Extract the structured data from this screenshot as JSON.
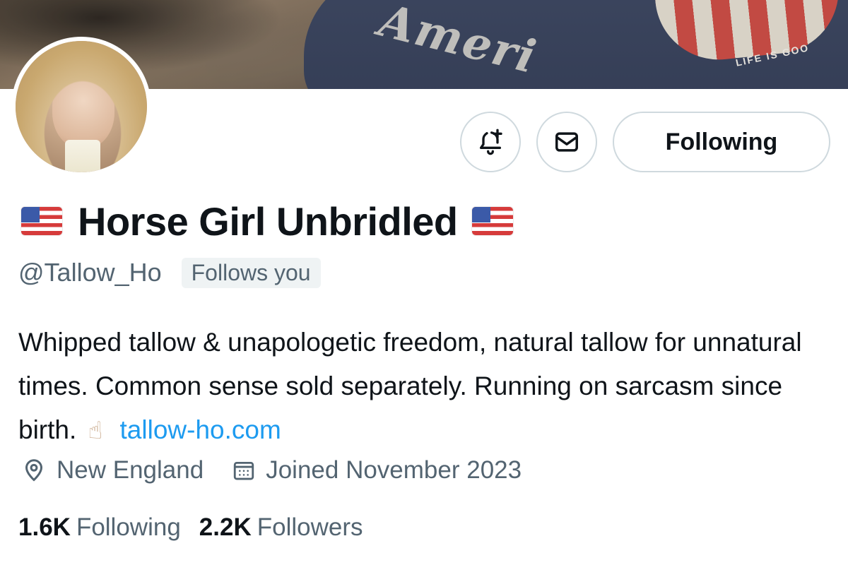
{
  "banner": {
    "shirt_text": "Ameri",
    "shirt_brand": "LIFE IS GOO"
  },
  "profile": {
    "display_name": "Horse Girl Unbridled",
    "name_prefix_emoji": "us-flag",
    "name_suffix_emoji": "us-flag",
    "handle": "@Tallow_Ho",
    "follows_you_badge": "Follows you",
    "bio_text": "Whipped tallow & unapologetic freedom, natural tallow for unnatural times. Common sense sold separately. Running on sarcasm since birth.",
    "bio_emoji": "middle-finger",
    "bio_link": "tallow-ho.com",
    "location": "New England",
    "joined": "Joined November 2023"
  },
  "actions": {
    "notify_icon": "bell-plus-icon",
    "message_icon": "envelope-icon",
    "following_label": "Following"
  },
  "stats": {
    "following_count": "1.6K",
    "following_label": "Following",
    "followers_count": "2.2K",
    "followers_label": "Followers"
  },
  "colors": {
    "text_primary": "#0f1419",
    "text_secondary": "#536471",
    "link": "#1d9bf0",
    "border": "#cfd9de",
    "badge_bg": "#eff3f4"
  }
}
